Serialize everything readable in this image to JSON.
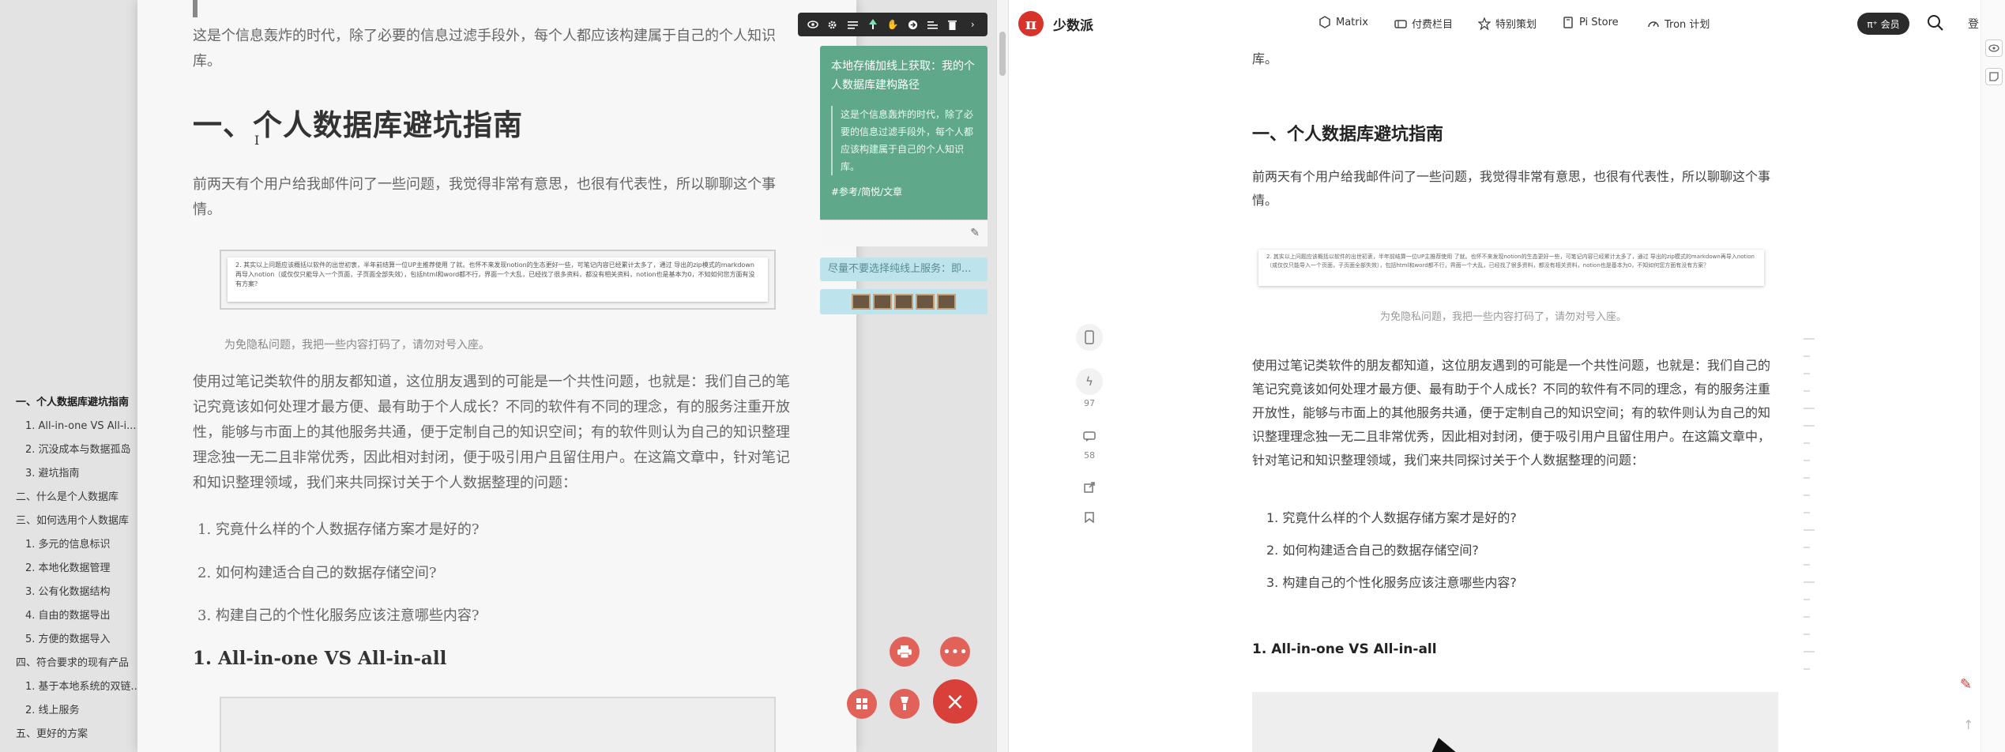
{
  "left": {
    "intro": "这是个信息轰炸的时代，除了必要的信息过滤手段外，每个人都应该构建属于自己的个人知识库。",
    "heading1": "一、个人数据库避坑指南",
    "cursor": "I",
    "para1": "前两天有个用户给我邮件问了一些问题，我觉得非常有意思，也很有代表性，所以聊聊这个事情。",
    "image_text": "2. 其实以上问题应该概括以软件的出世初衷，半年前结算一位UP主推荐使用       了就。也怀不来发现notion的生态更好一些，可笔记内容已经累计太多了，通过        导出的zip模式的markdown再导入notion（或仅仅只能导入一个页面，子页面全部失效），包括html和word都不行，界面一个大乱，已经找了很多资料，都没有相关资料，notion也是基本为0，不知如何您方面有没有方案？",
    "caption": "为免隐私问题，我把一些内容打码了，请勿对号入座。",
    "para2": "使用过笔记类软件的朋友都知道，这位朋友遇到的可能是一个共性问题，也就是：我们自己的笔记究竟该如何处理才最方便、最有助于个人成长？不同的软件有不同的理念，有的服务注重开放性，能够与市面上的其他服务共通，便于定制自己的知识空间；有的软件则认为自己的知识整理理念独一无二且非常优秀，因此相对封闭，便于吸引用户且留住用户。在这篇文章中，针对笔记和知识整理领域，我们来共同探讨关于个人数据整理的问题：",
    "list": [
      "究竟什么样的个人数据存储方案才是好的?",
      "如何构建适合自己的数据存储空间?",
      "构建自己的个性化服务应该注意哪些内容?"
    ],
    "heading2": "1. All-in-one VS All-in-all"
  },
  "toc": [
    {
      "label": "一、个人数据库避坑指南",
      "level": 1,
      "active": true
    },
    {
      "label": "1. All-in-one VS All-i...",
      "level": 2
    },
    {
      "label": "2. 沉没成本与数据孤岛",
      "level": 2
    },
    {
      "label": "3. 避坑指南",
      "level": 2
    },
    {
      "label": "二、什么是个人数据库",
      "level": 1
    },
    {
      "label": "三、如何选用个人数据库",
      "level": 1
    },
    {
      "label": "1. 多元的信息标识",
      "level": 2
    },
    {
      "label": "2. 本地化数据管理",
      "level": 2
    },
    {
      "label": "3. 公有化数据结构",
      "level": 2
    },
    {
      "label": "4. 自由的数据导出",
      "level": 2
    },
    {
      "label": "5. 方便的数据导入",
      "level": 2
    },
    {
      "label": "四、符合要求的现有产品",
      "level": 1
    },
    {
      "label": "1. 基于本地系统的双链...",
      "level": 2
    },
    {
      "label": "2. 线上服务",
      "level": 2
    },
    {
      "label": "五、更好的方案",
      "level": 1
    }
  ],
  "toolbar": {
    "icons": [
      "eye-icon",
      "gear-icon",
      "list-icon",
      "tree-icon",
      "hand-icon",
      "share-icon",
      "align-icon",
      "trash-icon",
      "chevron-right-icon"
    ]
  },
  "annotation": {
    "title": "本地存储加线上获取：我的个人数据库建构路径",
    "quote": "这是个信息轰炸的时代，除了必要的信息过滤手段外，每个人都应该构建属于自己的个人知识库。",
    "tag": "#参考/简悦/文章",
    "mini1": "尽量不要选择纯线上服务：即..."
  },
  "right": {
    "logo": "π",
    "brand": "少数派",
    "nav": [
      "Matrix",
      "付费栏目",
      "特别策划",
      "Pi Store",
      "Tron 计划"
    ],
    "member": "π⁺ 会员",
    "login": "登",
    "top_text": "库。",
    "heading": "一、个人数据库避坑指南",
    "para1": "前两天有个用户给我邮件问了一些问题，我觉得非常有意思，也很有代表性，所以聊聊这个事情。",
    "image_text": "2. 其实以上问题应该概括以软件的出世初衷，半年前结算一位UP主推荐使用       了就。也怀不来发现notion的生态更好一些，可笔记内容已经累计太多了，通过        导出的zip模式的markdown再导入notion（或仅仅只能导入一个页面，子页面全部失效），包括html和word都不行，界面一个大乱，已经找了很多资料，都没有相关资料，notion也是基本为0，不知如何您方面有没有方案？",
    "caption": "为免隐私问题，我把一些内容打码了，请勿对号入座。",
    "para2": "使用过笔记类软件的朋友都知道，这位朋友遇到的可能是一个共性问题，也就是：我们自己的笔记究竟该如何处理才最方便、最有助于个人成长？不同的软件有不同的理念，有的服务注重开放性，能够与市面上的其他服务共通，便于定制自己的知识空间；有的软件则认为自己的知识整理理念独一无二且非常优秀，因此相对封闭，便于吸引用户且留住用户。在这篇文章中，针对笔记和知识整理领域，我们来共同探讨关于个人数据整理的问题：",
    "list": [
      "1. 究竟什么样的个人数据存储方案才是好的?",
      "2. 如何构建适合自己的数据存储空间?",
      "3. 构建自己的个性化服务应该注意哪些内容?"
    ],
    "heading2": "1. All-in-one VS All-in-all",
    "share": {
      "likes": "97",
      "comments": "58"
    }
  },
  "colors": {
    "accent": "#d7332a",
    "annotation_green": "#5fa98a",
    "annotation_blue": "#bde4ec",
    "fab": "#e16259"
  }
}
